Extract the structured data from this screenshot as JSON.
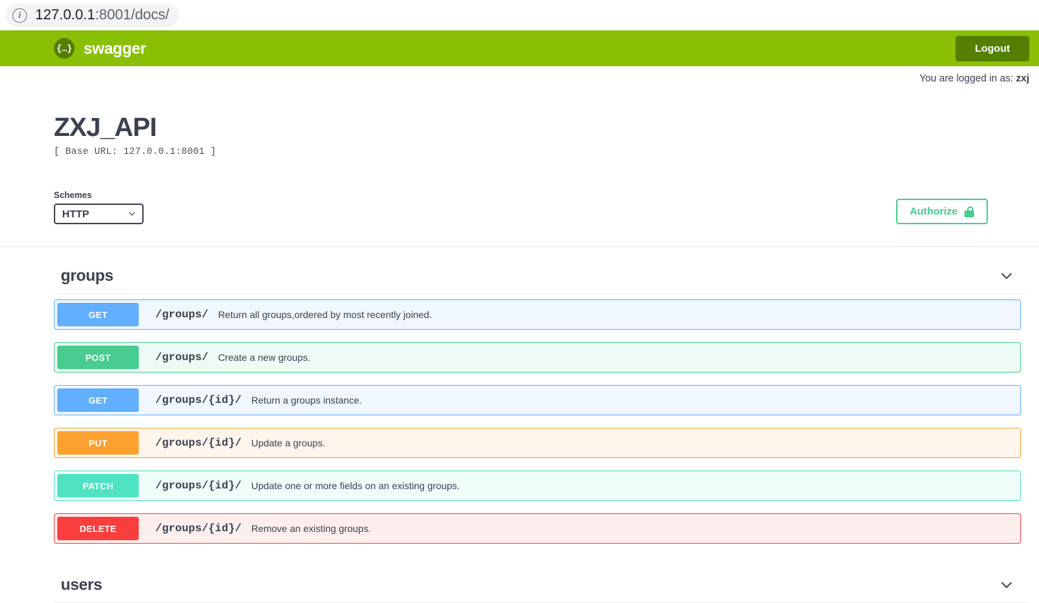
{
  "browser": {
    "info_icon": "info-circle-icon",
    "url_host": "127.0.0.1",
    "url_rest": ":8001/docs/"
  },
  "topbar": {
    "logo_glyph": "{…}",
    "brand": "swagger",
    "logout_label": "Logout",
    "bar_color": "#89bf04",
    "logout_color": "#547f00"
  },
  "auth_status": {
    "prefix": "You are logged in as: ",
    "username": "zxj"
  },
  "info": {
    "title": "ZXJ_API",
    "base_url": "[ Base URL: 127.0.0.1:8001 ]"
  },
  "schemes": {
    "label": "Schemes",
    "selected": "HTTP",
    "options": [
      "HTTP"
    ]
  },
  "authorize": {
    "label": "Authorize",
    "icon": "unlocked-padlock-icon",
    "color": "#49cc90"
  },
  "sections": [
    {
      "name": "groups",
      "expanded": true,
      "operations": [
        {
          "method": "GET",
          "path": "/groups/",
          "description": "Return all groups,ordered by most recently joined.",
          "color": "#61affe"
        },
        {
          "method": "POST",
          "path": "/groups/",
          "description": "Create a new groups.",
          "color": "#49cc90"
        },
        {
          "method": "GET",
          "path": "/groups/{id}/",
          "description": "Return a groups instance.",
          "color": "#61affe"
        },
        {
          "method": "PUT",
          "path": "/groups/{id}/",
          "description": "Update a groups.",
          "color": "#fca130"
        },
        {
          "method": "PATCH",
          "path": "/groups/{id}/",
          "description": "Update one or more fields on an existing groups.",
          "color": "#50e3c2"
        },
        {
          "method": "DELETE",
          "path": "/groups/{id}/",
          "description": "Remove an existing groups.",
          "color": "#f93e3e"
        }
      ]
    },
    {
      "name": "users",
      "expanded": true,
      "operations": []
    }
  ]
}
